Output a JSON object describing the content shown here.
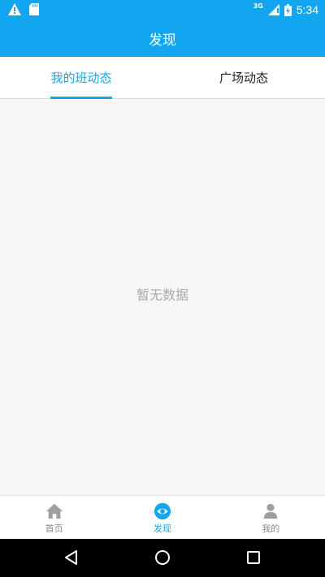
{
  "status_bar": {
    "time": "5:34",
    "network": "3G"
  },
  "app_bar": {
    "title": "发现"
  },
  "tabs": [
    {
      "label": "我的班动态",
      "active": true
    },
    {
      "label": "广场动态",
      "active": false
    }
  ],
  "content": {
    "empty_message": "暂无数据"
  },
  "bottom_nav": {
    "items": [
      {
        "label": "首页",
        "icon": "home-icon",
        "active": false
      },
      {
        "label": "发现",
        "icon": "eye-icon",
        "active": true
      },
      {
        "label": "我的",
        "icon": "person-icon",
        "active": false
      }
    ]
  },
  "colors": {
    "primary": "#12a6f1",
    "inactive": "#888888",
    "background": "#f7f7f7",
    "empty_text": "#a8a8a8"
  }
}
